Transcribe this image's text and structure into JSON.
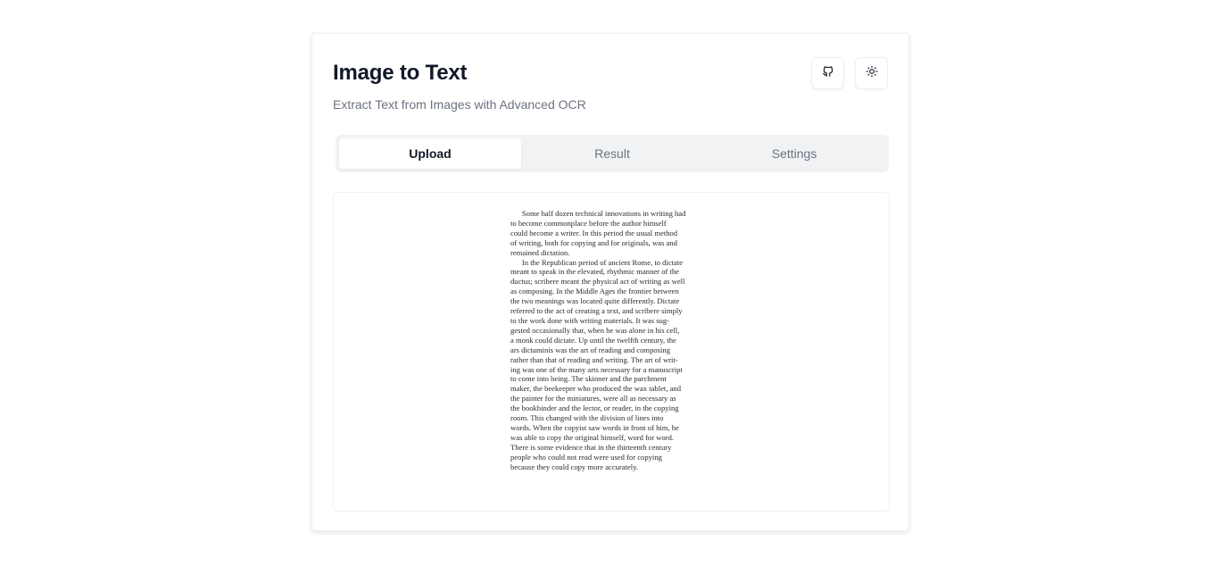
{
  "app": {
    "title": "Image to Text",
    "subtitle": "Extract Text from Images with Advanced OCR"
  },
  "header_actions": {
    "github_icon": "github-icon",
    "theme_icon": "sun-icon"
  },
  "tabs": [
    {
      "label": "Upload",
      "active": true
    },
    {
      "label": "Result",
      "active": false
    },
    {
      "label": "Settings",
      "active": false
    }
  ],
  "uploaded_image": {
    "lines": [
      "    Some half dozen technical innovations in writing had",
      "to become commonplace before the author himself",
      "could become a writer. In this period the usual method",
      "of writing, both for copying and for originals, was and",
      "remained dictation.",
      "    In the Republican period of ancient Rome, to dictate",
      "meant to speak in the elevated, rhythmic manner of the",
      "ductus; scribere meant the physical act of writing as well",
      "as composing. In the Middle Ages the frontier between",
      "the two meanings was located quite differently. Dictate",
      "referred to the act of creating a text, and scribere simply",
      "to the work done with writing materials. It was sug-",
      "gested occasionally that, when he was alone in his cell,",
      "a monk could dictate. Up until the twelfth century, the",
      "ars dictaminis was the art of reading and composing",
      "rather than that of reading and writing. The art of writ-",
      "ing was one of the many arts necessary for a manuscript",
      "to come into being. The skinner and the parchment",
      "maker, the beekeeper who produced the wax tablet, and",
      "the painter for the miniatures, were all as necessary as",
      "the bookbinder and the lector, or reader, in the copying",
      "room. This changed with the division of lines into",
      "words. When the copyist saw words in front of him, he",
      "was able to copy the original himself, word for word.",
      "There is some evidence that in the thirteenth century",
      "people who could not read were used for copying",
      "because they could copy more accurately."
    ]
  }
}
